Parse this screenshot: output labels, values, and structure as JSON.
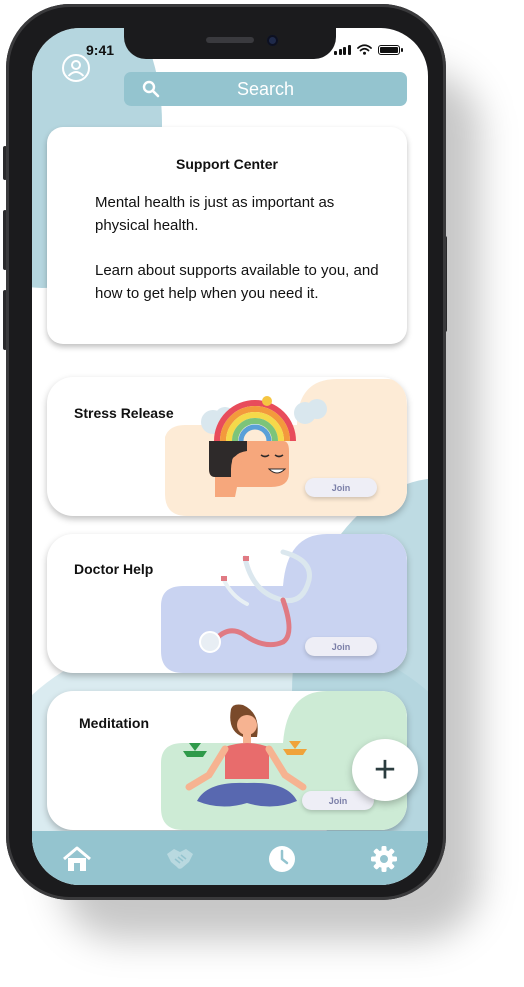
{
  "status_bar": {
    "time": "9:41"
  },
  "search": {
    "placeholder": "Search"
  },
  "support_center": {
    "title": "Support Center",
    "paragraph_1": "Mental health is just as important as physical health.",
    "paragraph_2": "Learn about supports available to you, and how to get help when you need it."
  },
  "cards": [
    {
      "title": "Stress Release",
      "join_label": "Join",
      "bg_color": "#fdebd6"
    },
    {
      "title": "Doctor Help",
      "join_label": "Join",
      "bg_color": "#c9d3f1"
    },
    {
      "title": "Meditation",
      "join_label": "Join",
      "bg_color": "#cdebd5"
    }
  ],
  "fab": {
    "label": "+"
  },
  "nav": {
    "items": [
      "home-icon",
      "handshake-icon",
      "clock-icon",
      "gear-icon"
    ]
  },
  "colors": {
    "accent": "#94c4cf",
    "blob": "#a8cfd9",
    "device": "#1b1b1d"
  }
}
